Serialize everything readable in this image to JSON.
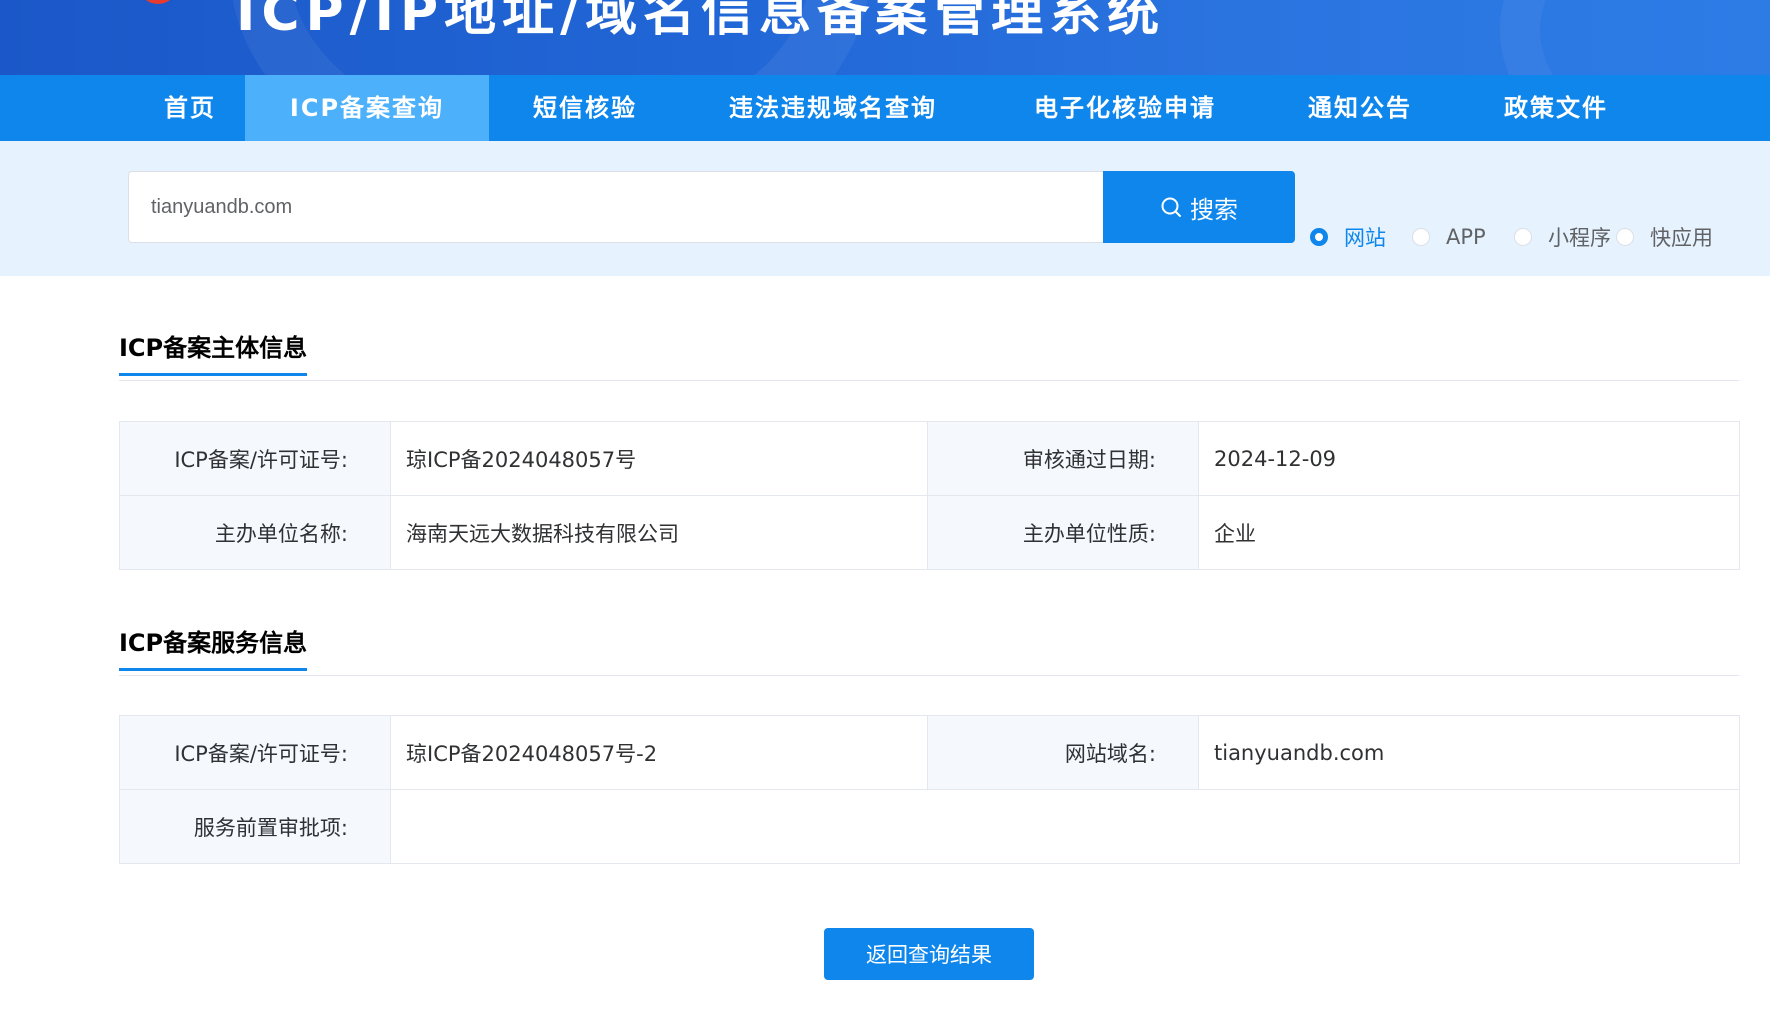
{
  "header": {
    "title": "ICP/IP地址/域名信息备案管理系统"
  },
  "nav": {
    "items": [
      {
        "label": "首页"
      },
      {
        "label": "ICP备案查询"
      },
      {
        "label": "短信核验"
      },
      {
        "label": "违法违规域名查询"
      },
      {
        "label": "电子化核验申请"
      },
      {
        "label": "通知公告"
      },
      {
        "label": "政策文件"
      }
    ],
    "active_index": 1
  },
  "search": {
    "value": "tianyuandb.com",
    "button_label": "搜索",
    "types": [
      {
        "label": "网站",
        "checked": true
      },
      {
        "label": "APP",
        "checked": false
      },
      {
        "label": "小程序",
        "checked": false
      },
      {
        "label": "快应用",
        "checked": false
      }
    ]
  },
  "entity_section": {
    "title": "ICP备案主体信息",
    "rows": [
      {
        "label1": "ICP备案/许可证号:",
        "value1": "琼ICP备2024048057号",
        "label2": "审核通过日期:",
        "value2": "2024-12-09"
      },
      {
        "label1": "主办单位名称:",
        "value1": "海南天远大数据科技有限公司",
        "label2": "主办单位性质:",
        "value2": "企业"
      }
    ]
  },
  "service_section": {
    "title": "ICP备案服务信息",
    "license_label": "ICP备案/许可证号:",
    "license_value": "琼ICP备2024048057号-2",
    "domain_label": "网站域名:",
    "domain_value": "tianyuandb.com",
    "approval_label": "服务前置审批项:",
    "approval_value": ""
  },
  "back_button_label": "返回查询结果",
  "colors": {
    "primary": "#0e86ec",
    "nav_active": "#4db0fb",
    "search_bg": "#e6f3fe",
    "label_bg": "#f5f9fe"
  }
}
